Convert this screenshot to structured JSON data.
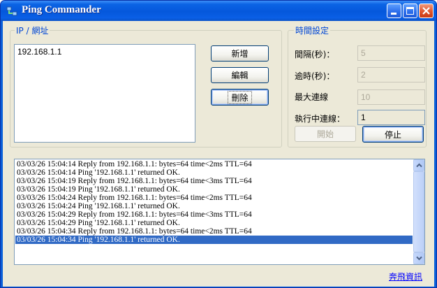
{
  "window": {
    "title": "Ping Commander",
    "icon": "app-network-icon"
  },
  "titlebar_buttons": {
    "minimize": "minimize-icon",
    "maximize": "maximize-icon",
    "close": "close-icon"
  },
  "ip_group": {
    "legend": "IP / 網址",
    "items": [
      "192.168.1.1"
    ],
    "buttons": {
      "add": "新增",
      "edit": "編輯",
      "delete": "刪除"
    }
  },
  "time_group": {
    "legend": "時間設定",
    "interval_label": "間隔(秒)：",
    "interval_value": "5",
    "timeout_label": "逾時(秒)：",
    "timeout_value": "2",
    "max_conn_label": "最大連線",
    "max_conn_value": "10",
    "running_label": "執行中連線：",
    "running_value": "1",
    "start_label": "開始",
    "stop_label": "停止"
  },
  "log": {
    "lines": [
      "03/03/26 15:04:14 Reply from 192.168.1.1: bytes=64 time<2ms TTL=64",
      "03/03/26 15:04:14 Ping '192.168.1.1' returned OK.",
      "03/03/26 15:04:19 Reply from 192.168.1.1: bytes=64 time<3ms TTL=64",
      "03/03/26 15:04:19 Ping '192.168.1.1' returned OK.",
      "03/03/26 15:04:24 Reply from 192.168.1.1: bytes=64 time<2ms TTL=64",
      "03/03/26 15:04:24 Ping '192.168.1.1' returned OK.",
      "03/03/26 15:04:29 Reply from 192.168.1.1: bytes=64 time<3ms TTL=64",
      "03/03/26 15:04:29 Ping '192.168.1.1' returned OK.",
      "03/03/26 15:04:34 Reply from 192.168.1.1: bytes=64 time<2ms TTL=64",
      "03/03/26 15:04:34 Ping '192.168.1.1' returned OK."
    ],
    "selected_index": 9
  },
  "footer": {
    "link": "奔飛資訊"
  },
  "colors": {
    "titlebar": "#0558dc",
    "dialog": "#ece9d8",
    "selection": "#316ac5",
    "link": "#0000ff"
  }
}
